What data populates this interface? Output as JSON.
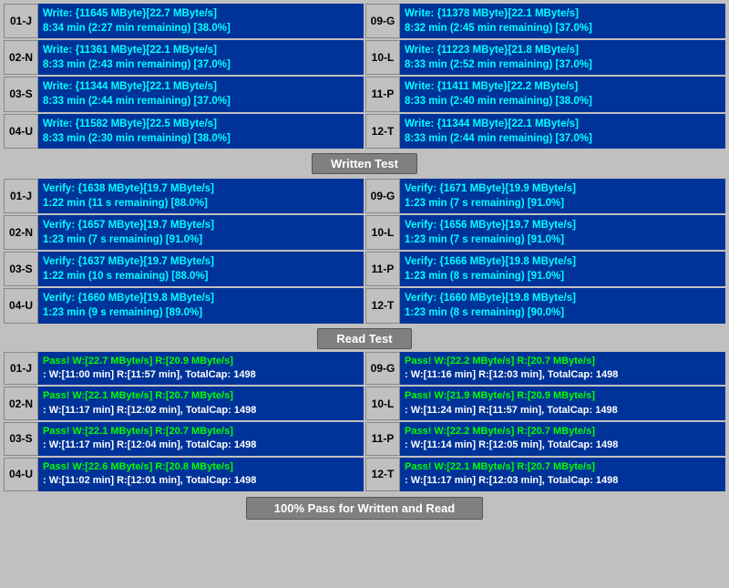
{
  "sections": {
    "write_test": {
      "label": "Written Test",
      "rows": [
        {
          "left_id": "01-J",
          "left_line1": "Write: {11645 MByte}[22.7 MByte/s]",
          "left_line2": "8:34 min (2:27 min remaining)  [38.0%]",
          "right_id": "09-G",
          "right_line1": "Write: {11378 MByte}[22.1 MByte/s]",
          "right_line2": "8:32 min (2:45 min remaining)  [37.0%]"
        },
        {
          "left_id": "02-N",
          "left_line1": "Write: {11361 MByte}[22.1 MByte/s]",
          "left_line2": "8:33 min (2:43 min remaining)  [37.0%]",
          "right_id": "10-L",
          "right_line1": "Write: {11223 MByte}[21.8 MByte/s]",
          "right_line2": "8:33 min (2:52 min remaining)  [37.0%]"
        },
        {
          "left_id": "03-S",
          "left_line1": "Write: {11344 MByte}[22.1 MByte/s]",
          "left_line2": "8:33 min (2:44 min remaining)  [37.0%]",
          "right_id": "11-P",
          "right_line1": "Write: {11411 MByte}[22.2 MByte/s]",
          "right_line2": "8:33 min (2:40 min remaining)  [38.0%]"
        },
        {
          "left_id": "04-U",
          "left_line1": "Write: {11582 MByte}[22.5 MByte/s]",
          "left_line2": "8:33 min (2:30 min remaining)  [38.0%]",
          "right_id": "12-T",
          "right_line1": "Write: {11344 MByte}[22.1 MByte/s]",
          "right_line2": "8:33 min (2:44 min remaining)  [37.0%]"
        }
      ]
    },
    "verify_test": {
      "label": "Written Test",
      "rows": [
        {
          "left_id": "01-J",
          "left_line1": "Verify: {1638 MByte}[19.7 MByte/s]",
          "left_line2": "1:22 min (11 s remaining)   [88.0%]",
          "right_id": "09-G",
          "right_line1": "Verify: {1671 MByte}[19.9 MByte/s]",
          "right_line2": "1:23 min (7 s remaining)   [91.0%]"
        },
        {
          "left_id": "02-N",
          "left_line1": "Verify: {1657 MByte}[19.7 MByte/s]",
          "left_line2": "1:23 min (7 s remaining)   [91.0%]",
          "right_id": "10-L",
          "right_line1": "Verify: {1656 MByte}[19.7 MByte/s]",
          "right_line2": "1:23 min (7 s remaining)   [91.0%]"
        },
        {
          "left_id": "03-S",
          "left_line1": "Verify: {1637 MByte}[19.7 MByte/s]",
          "left_line2": "1:22 min (10 s remaining)   [88.0%]",
          "right_id": "11-P",
          "right_line1": "Verify: {1666 MByte}[19.8 MByte/s]",
          "right_line2": "1:23 min (8 s remaining)   [91.0%]"
        },
        {
          "left_id": "04-U",
          "left_line1": "Verify: {1660 MByte}[19.8 MByte/s]",
          "left_line2": "1:23 min (9 s remaining)   [89.0%]",
          "right_id": "12-T",
          "right_line1": "Verify: {1660 MByte}[19.8 MByte/s]",
          "right_line2": "1:23 min (8 s remaining)   [90.0%]"
        }
      ]
    },
    "read_test": {
      "label": "Read Test",
      "rows": [
        {
          "left_id": "01-J",
          "left_line1": "Pass! W:[22.7 MByte/s] R:[20.9 MByte/s]",
          "left_line2": ": W:[11:00 min] R:[11:57 min], TotalCap: 1498",
          "right_id": "09-G",
          "right_line1": "Pass! W:[22.2 MByte/s] R:[20.7 MByte/s]",
          "right_line2": ": W:[11:16 min] R:[12:03 min], TotalCap: 1498"
        },
        {
          "left_id": "02-N",
          "left_line1": "Pass! W:[22.1 MByte/s] R:[20.7 MByte/s]",
          "left_line2": ": W:[11:17 min] R:[12:02 min], TotalCap: 1498",
          "right_id": "10-L",
          "right_line1": "Pass! W:[21.9 MByte/s] R:[20.9 MByte/s]",
          "right_line2": ": W:[11:24 min] R:[11:57 min], TotalCap: 1498"
        },
        {
          "left_id": "03-S",
          "left_line1": "Pass! W:[22.1 MByte/s] R:[20.7 MByte/s]",
          "left_line2": ": W:[11:17 min] R:[12:04 min], TotalCap: 1498",
          "right_id": "11-P",
          "right_line1": "Pass! W:[22.2 MByte/s] R:[20.7 MByte/s]",
          "right_line2": ": W:[11:14 min] R:[12:05 min], TotalCap: 1498"
        },
        {
          "left_id": "04-U",
          "left_line1": "Pass! W:[22.6 MByte/s] R:[20.8 MByte/s]",
          "left_line2": ": W:[11:02 min] R:[12:01 min], TotalCap: 1498",
          "right_id": "12-T",
          "right_line1": "Pass! W:[22.1 MByte/s] R:[20.7 MByte/s]",
          "right_line2": ": W:[11:17 min] R:[12:03 min], TotalCap: 1498"
        }
      ]
    }
  },
  "labels": {
    "written_test": "Written Test",
    "read_test": "Read Test",
    "footer": "100% Pass for Written and Read"
  }
}
